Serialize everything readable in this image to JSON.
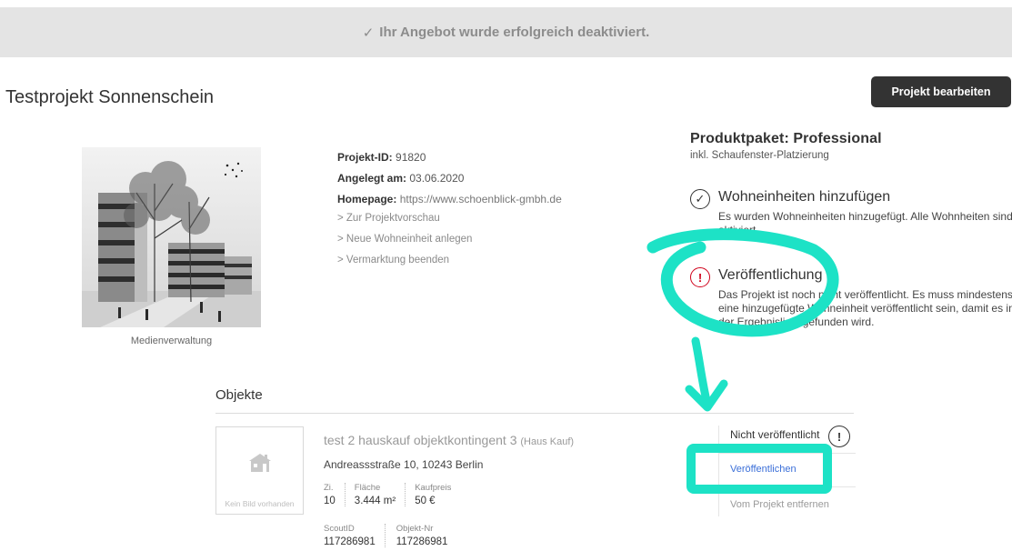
{
  "banner": {
    "check_icon": "✓",
    "message": "Ihr Angebot wurde erfolgreich deaktiviert."
  },
  "project": {
    "title": "Testprojekt Sonnenschein",
    "edit_button": "Projekt bearbeiten",
    "media_label": "Medienverwaltung",
    "id_label": "Projekt-ID:",
    "id_value": "91820",
    "created_label": "Angelegt am:",
    "created_value": "03.06.2020",
    "homepage_label": "Homepage:",
    "homepage_value": "https://www.schoenblick-gmbh.de",
    "actions": [
      "> Zur Projektvorschau",
      "> Neue Wohneinheit anlegen",
      "> Vermarktung beenden"
    ]
  },
  "package": {
    "title": "Produktpaket: Professional",
    "subtitle": "inkl. Schaufenster-Platzierung",
    "steps": [
      {
        "icon": "checkmark-circle-icon",
        "title": "Wohneinheiten hinzufügen",
        "desc": "Es wurden Wohneinheiten hinzugefügt. Alle Wohnheiten sind aktiviert."
      },
      {
        "icon": "exclamation-circle-icon",
        "title": "Veröffentlichung",
        "desc": "Das Projekt ist noch nicht veröffentlicht. Es muss mindestens eine hinzugefügte Wohneinheit veröffentlicht sein, damit es in der Ergebnisliste gefunden wird."
      }
    ]
  },
  "objects": {
    "heading": "Objekte",
    "items": [
      {
        "no_image": "Kein Bild vorhanden",
        "title": "test 2 hauskauf objektkontingent 3",
        "type": "(Haus Kauf)",
        "address": "Andreassstraße 10, 10243 Berlin",
        "facts": [
          {
            "label": "Zi.",
            "value": "10"
          },
          {
            "label": "Fläche",
            "value": "3.444 m²"
          },
          {
            "label": "Kaufpreis",
            "value": "50 €"
          }
        ],
        "ids": [
          {
            "label": "ScoutID",
            "value": "117286981"
          },
          {
            "label": "Objekt-Nr",
            "value": "117286981"
          }
        ],
        "status": "Nicht veröffentlicht",
        "status_icon": "!",
        "publish": "Veröffentlichen",
        "remove": "Vom Projekt entfernen"
      }
    ]
  },
  "colors": {
    "annotation": "#1de2c6",
    "warning": "#d0021b",
    "link": "#3b6fd8",
    "button_bg": "#333333"
  }
}
